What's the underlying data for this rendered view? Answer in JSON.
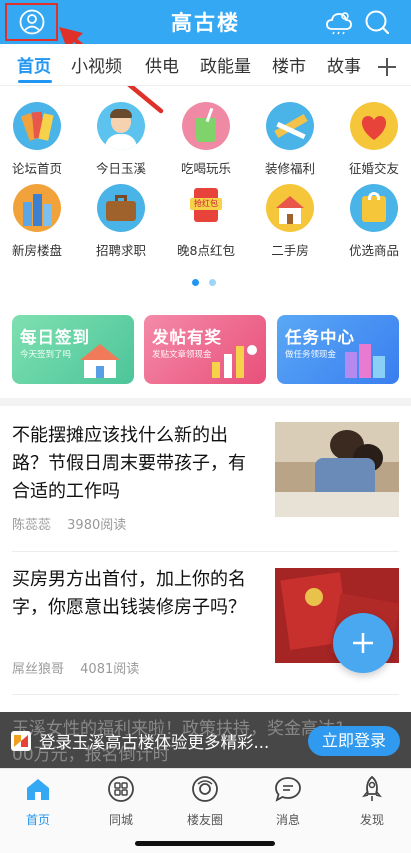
{
  "header": {
    "title": "高古楼"
  },
  "tabs": [
    {
      "label": "首页",
      "active": true
    },
    {
      "label": "小视频"
    },
    {
      "label": "供电"
    },
    {
      "label": "政能量"
    },
    {
      "label": "楼市"
    },
    {
      "label": "故事"
    }
  ],
  "grid": [
    {
      "label": "论坛首页",
      "icon": "forum-icon"
    },
    {
      "label": "今日玉溪",
      "icon": "person-icon"
    },
    {
      "label": "吃喝玩乐",
      "icon": "drink-icon"
    },
    {
      "label": "装修福利",
      "icon": "ruler-icon"
    },
    {
      "label": "征婚交友",
      "icon": "heart-icon"
    },
    {
      "label": "新房楼盘",
      "icon": "buildings-icon"
    },
    {
      "label": "招聘求职",
      "icon": "briefcase-icon"
    },
    {
      "label": "晚8点红包",
      "icon": "red-packet-icon",
      "badge": "抢红包"
    },
    {
      "label": "二手房",
      "icon": "house-icon"
    },
    {
      "label": "优选商品",
      "icon": "bag-icon"
    }
  ],
  "cards": [
    {
      "title": "每日签到",
      "sub": "今天签到了吗",
      "color": "#5fcf9a"
    },
    {
      "title": "发帖有奖",
      "sub": "发贴文章领现金",
      "color": "#ec5f8a"
    },
    {
      "title": "任务中心",
      "sub": "做任务领现金",
      "color": "#3d8ff0"
    }
  ],
  "articles": [
    {
      "title": "不能摆摊应该找什么新的出路？节假日周末要带孩子，有合适的工作吗",
      "author": "陈蕊蕊",
      "reads": "3980阅读"
    },
    {
      "title": "买房男方出首付，加上你的名字，你愿意出钱装修房子吗？",
      "author": "屌丝狼哥",
      "reads": "4081阅读"
    }
  ],
  "banner": {
    "bg_line1": "玉溪女性的福利来啦！政策扶持，奖金高达1",
    "bg_line2": "00万元，报名倒计时",
    "text": "登录玉溪高古楼体验更多精彩...",
    "button": "立即登录"
  },
  "nav": [
    {
      "label": "首页",
      "active": true
    },
    {
      "label": "同城"
    },
    {
      "label": "楼友圈"
    },
    {
      "label": "消息"
    },
    {
      "label": "发现"
    }
  ],
  "colors": {
    "primary": "#35a8f3",
    "active_tab": "#2196f3",
    "annotation": "#e0302a"
  }
}
